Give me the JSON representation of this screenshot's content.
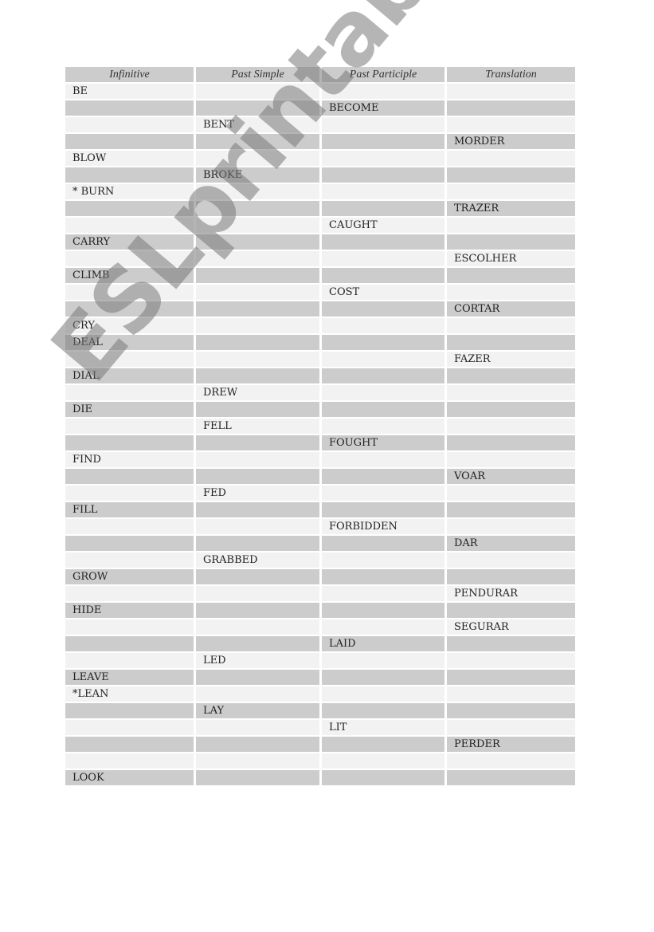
{
  "table": {
    "headers": [
      "Infinitive",
      "Past Simple",
      "Past Participle",
      "Translation"
    ],
    "rows": [
      [
        "BE",
        "",
        "",
        ""
      ],
      [
        "",
        "",
        "BECOME",
        ""
      ],
      [
        "",
        "BENT",
        "",
        ""
      ],
      [
        "",
        "",
        "",
        "MORDER"
      ],
      [
        "BLOW",
        "",
        "",
        ""
      ],
      [
        "",
        "BROKE",
        "",
        ""
      ],
      [
        "* BURN",
        "",
        "",
        ""
      ],
      [
        "",
        "",
        "",
        "TRAZER"
      ],
      [
        "",
        "",
        "CAUGHT",
        ""
      ],
      [
        "CARRY",
        "",
        "",
        ""
      ],
      [
        "",
        "",
        "",
        "ESCOLHER"
      ],
      [
        "CLIMB",
        "",
        "",
        ""
      ],
      [
        "",
        "",
        "COST",
        ""
      ],
      [
        "",
        "",
        "",
        "CORTAR"
      ],
      [
        "CRY",
        "",
        "",
        ""
      ],
      [
        "DEAL",
        "",
        "",
        ""
      ],
      [
        "",
        "",
        "",
        "FAZER"
      ],
      [
        "DIAL",
        "",
        "",
        ""
      ],
      [
        "",
        "DREW",
        "",
        ""
      ],
      [
        "DIE",
        "",
        "",
        ""
      ],
      [
        "",
        "FELL",
        "",
        ""
      ],
      [
        "",
        "",
        "FOUGHT",
        ""
      ],
      [
        "FIND",
        "",
        "",
        ""
      ],
      [
        "",
        "",
        "",
        "VOAR"
      ],
      [
        "",
        "FED",
        "",
        ""
      ],
      [
        "FILL",
        "",
        "",
        ""
      ],
      [
        "",
        "",
        "FORBIDDEN",
        ""
      ],
      [
        "",
        "",
        "",
        "DAR"
      ],
      [
        "",
        "GRABBED",
        "",
        ""
      ],
      [
        "GROW",
        "",
        "",
        ""
      ],
      [
        "",
        "",
        "",
        "PENDURAR"
      ],
      [
        "HIDE",
        "",
        "",
        ""
      ],
      [
        "",
        "",
        "",
        "SEGURAR"
      ],
      [
        "",
        "",
        "LAID",
        ""
      ],
      [
        "",
        "LED",
        "",
        ""
      ],
      [
        "LEAVE",
        "",
        "",
        ""
      ],
      [
        "*LEAN",
        "",
        "",
        ""
      ],
      [
        "",
        "LAY",
        "",
        ""
      ],
      [
        "",
        "",
        "LIT",
        ""
      ],
      [
        "",
        "",
        "",
        "PERDER"
      ],
      [
        "",
        "",
        "",
        ""
      ],
      [
        "LOOK",
        "",
        "",
        ""
      ]
    ]
  },
  "watermark": "ESLprintables.com",
  "colors": {
    "header_bg": "#cccccc",
    "dark_row": "#cccccc",
    "light_row": "#f2f2f2"
  }
}
